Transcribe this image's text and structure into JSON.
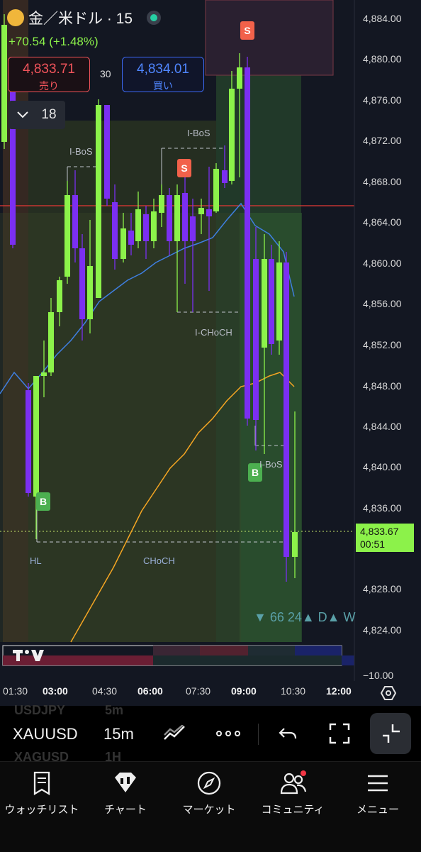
{
  "header": {
    "title": "金／米ドル · 15",
    "change": "+70.54 (+1.48%)"
  },
  "trade": {
    "sell_price": "4,833.71",
    "sell_label": "売り",
    "spread": "30",
    "buy_price": "4,834.01",
    "buy_label": "買い"
  },
  "indicator_toggle": {
    "value": "18"
  },
  "chart": {
    "price_axis": [
      "4,884.00",
      "4,880.00",
      "4,876.00",
      "4,872.00",
      "4,868.00",
      "4,864.00",
      "4,860.00",
      "4,856.00",
      "4,852.00",
      "4,848.00",
      "4,844.00",
      "4,840.00",
      "4,836.00",
      "4,828.00",
      "4,824.00",
      "−10.00"
    ],
    "time_axis": [
      {
        "label": "01:30",
        "bold": false
      },
      {
        "label": "03:00",
        "bold": true
      },
      {
        "label": "04:30",
        "bold": false
      },
      {
        "label": "06:00",
        "bold": true
      },
      {
        "label": "07:30",
        "bold": false
      },
      {
        "label": "09:00",
        "bold": true
      },
      {
        "label": "10:30",
        "bold": false
      },
      {
        "label": "12:00",
        "bold": true
      }
    ],
    "current_price": "4,833.67",
    "countdown": "00:51",
    "annotations": {
      "ibos1": "I-BoS",
      "ibos2": "I-BoS",
      "ibos3": "I-BoS",
      "ichoch": "I-CHoCH",
      "hl": "HL",
      "choch": "CHoCH",
      "bottom_tags": "▼ 66 24▲ D▲ W"
    },
    "signals": {
      "sell": "S",
      "buy": "B"
    },
    "colors": {
      "bull": "#8cf24a",
      "bear": "#7b2ff2",
      "ma_blue": "#3f7fe0",
      "ma_orange": "#f5a623",
      "price_line": "#e53935"
    }
  },
  "toolbar": {
    "symbol": "XAUUSD",
    "timeframe": "15m",
    "ghost_symbol_top": "USDJPY",
    "ghost_tf_top": "5m",
    "ghost_symbol_bottom": "XAGUSD",
    "ghost_tf_bottom": "1H",
    "icons": [
      "drawing-tools-icon",
      "more-icon",
      "undo-icon",
      "fullscreen-icon",
      "collapse-icon"
    ]
  },
  "nav": [
    {
      "label": "ウォッチリスト",
      "icon": "watchlist-icon"
    },
    {
      "label": "チャート",
      "icon": "chart-icon"
    },
    {
      "label": "マーケット",
      "icon": "compass-icon"
    },
    {
      "label": "コミュニティ",
      "icon": "community-icon"
    },
    {
      "label": "メニュー",
      "icon": "menu-icon"
    }
  ]
}
